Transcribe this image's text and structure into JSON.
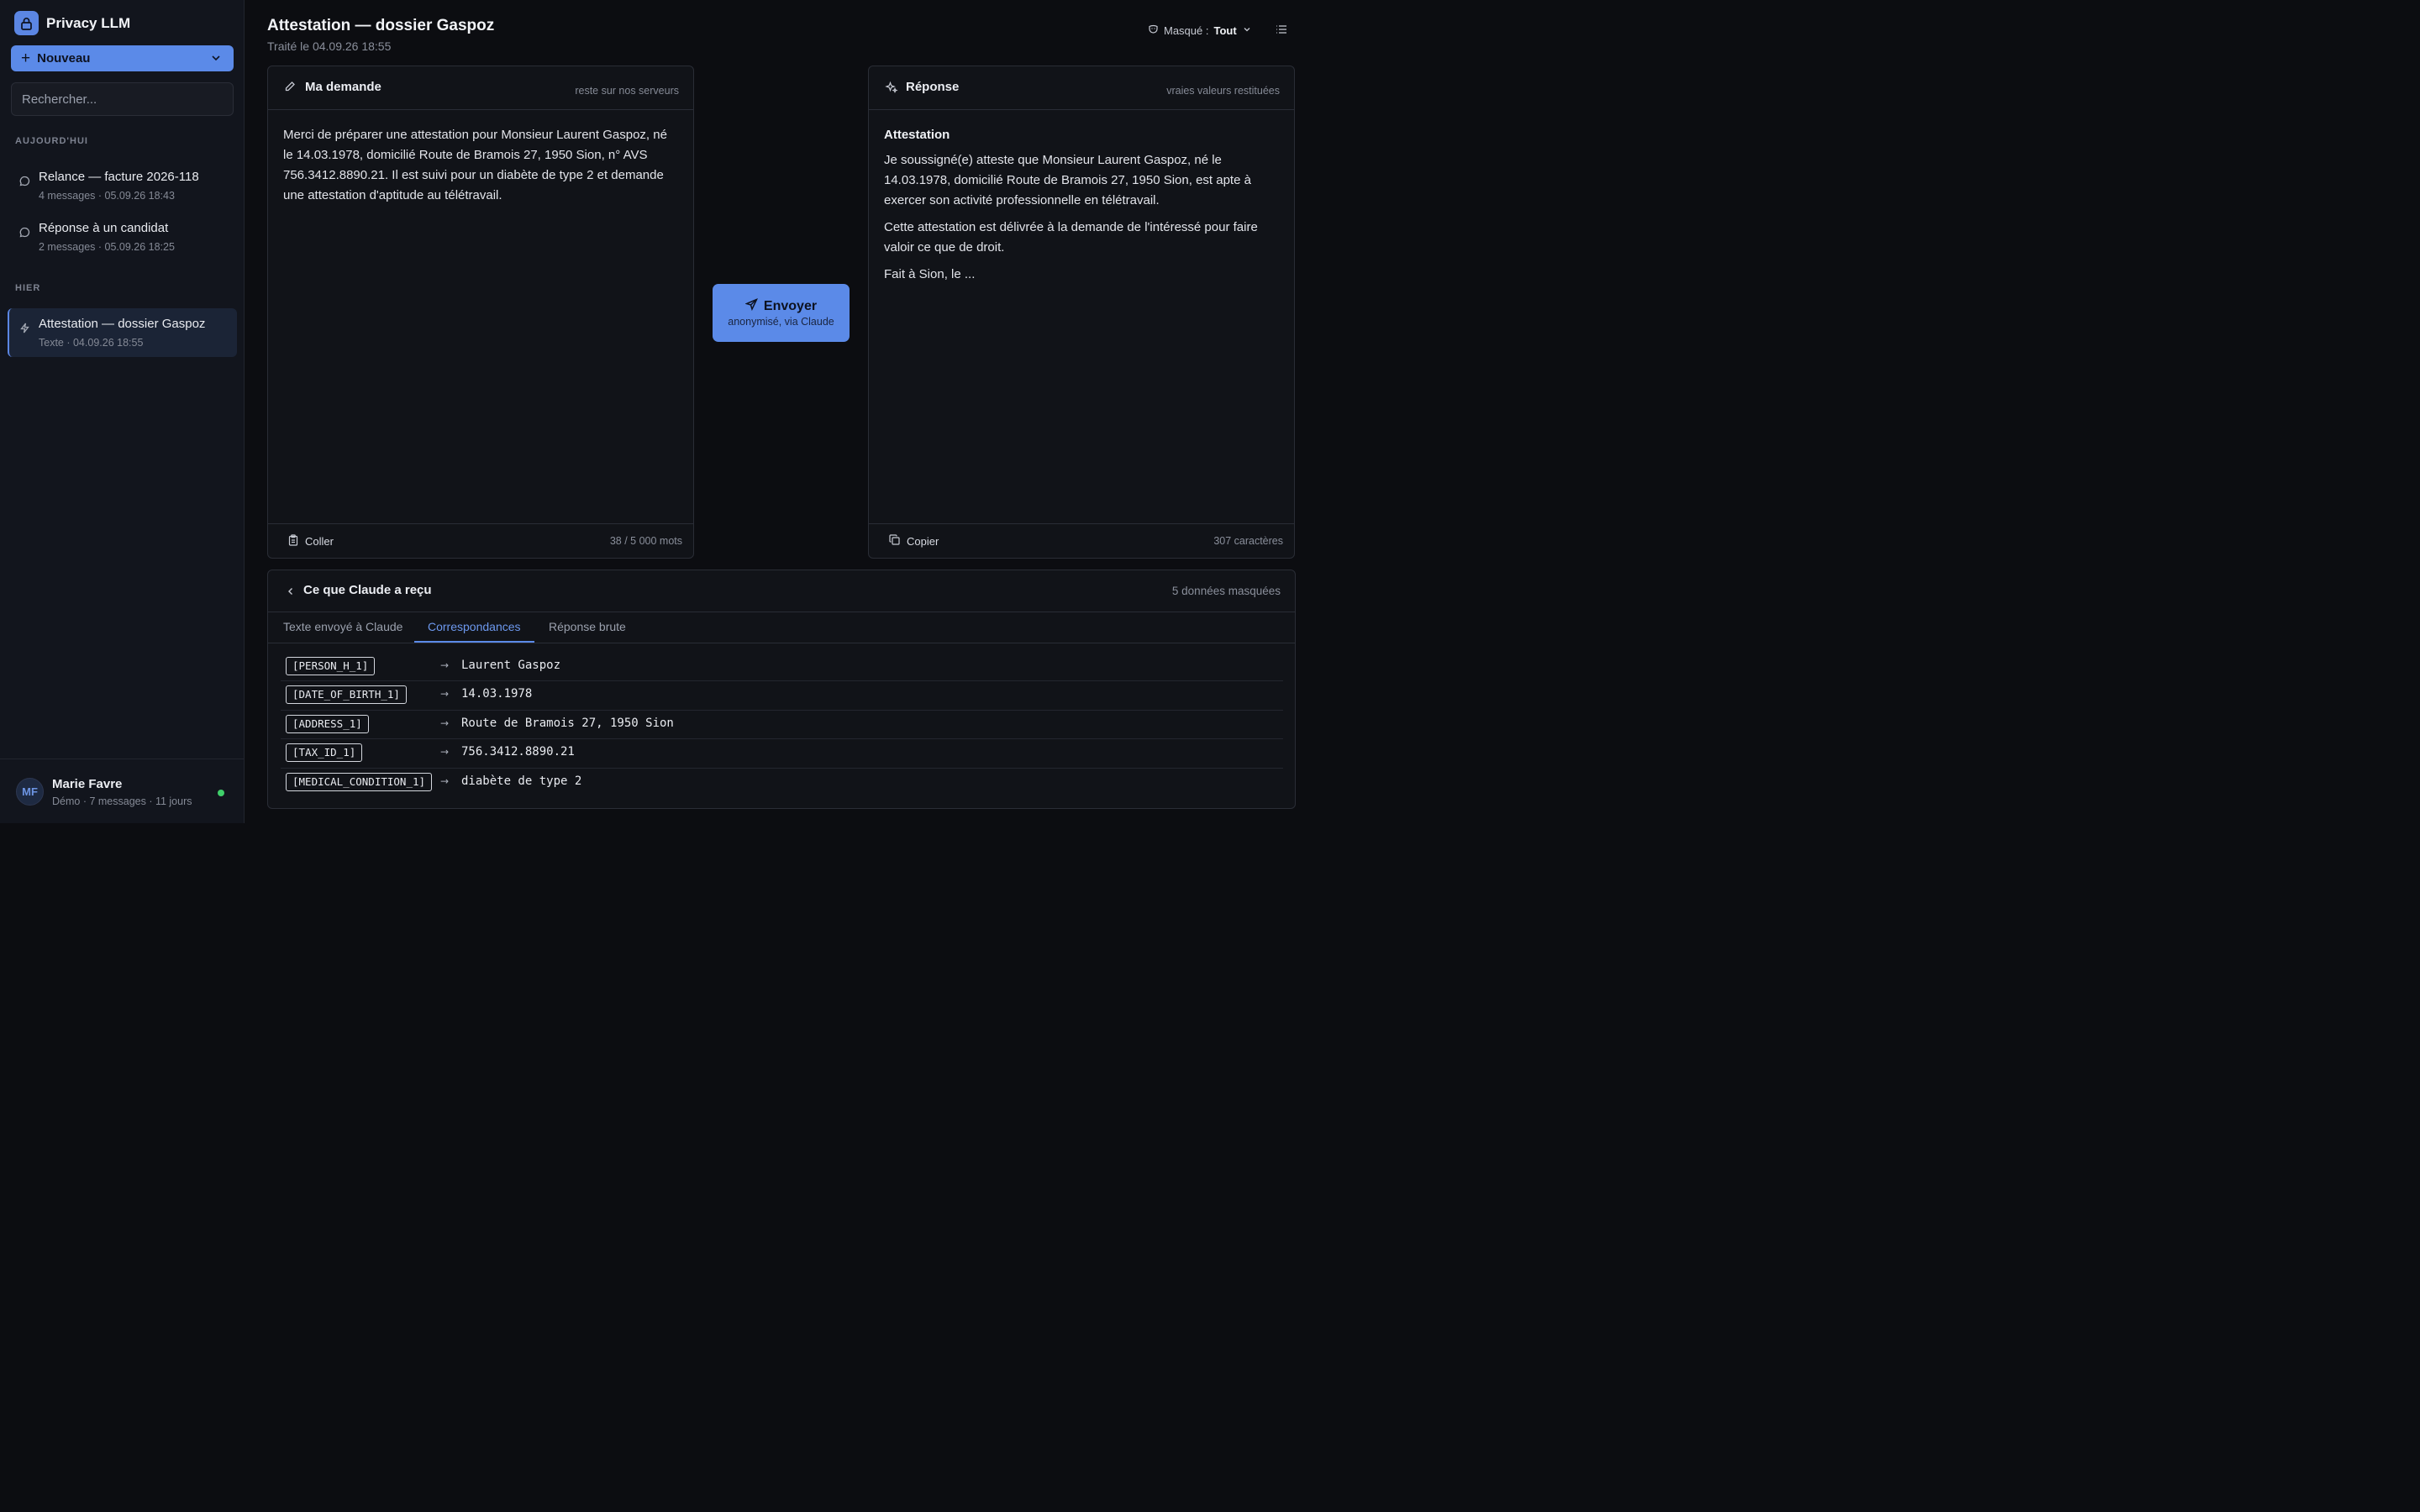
{
  "app": {
    "name": "Privacy LLM",
    "accent": "#5b8ae8"
  },
  "sidebar": {
    "new_button": "Nouveau",
    "search_placeholder": "Rechercher...",
    "sections": [
      {
        "label": "AUJOURD'HUI",
        "items": [
          {
            "title": "Relance — facture 2026-118",
            "meta": "4 messages · 05.09.26 18:43",
            "icon": "chat-bubble-icon"
          },
          {
            "title": "Réponse à un candidat",
            "meta": "2 messages · 05.09.26 18:25",
            "icon": "chat-bubble-icon"
          }
        ]
      },
      {
        "label": "HIER",
        "items": [
          {
            "title": "Attestation — dossier Gaspoz",
            "meta": "Texte · 04.09.26 18:55",
            "icon": "lightning-icon",
            "active": true
          }
        ]
      }
    ],
    "user": {
      "initials": "MF",
      "name": "Marie Favre",
      "meta": "Démo · 7 messages · 11 jours",
      "status_color": "#3fcf6a"
    }
  },
  "header": {
    "title": "Attestation — dossier Gaspoz",
    "subtitle": "Traité le 04.09.26 18:55",
    "mask_label": "Masqué :",
    "mask_value": "Tout"
  },
  "request_panel": {
    "title": "Ma demande",
    "note": "reste sur nos serveurs",
    "text": "Merci de préparer une attestation pour Monsieur Laurent Gaspoz, né le 14.03.1978, domicilié Route de Bramois 27, 1950 Sion, n° AVS 756.3412.8890.21. Il est suivi pour un diabète de type 2 et demande une attestation d'aptitude au télétravail.",
    "footer_button": "Coller",
    "count": "38 / 5 000 mots"
  },
  "send_button": {
    "label": "Envoyer",
    "sublabel": "anonymisé, via Claude"
  },
  "response_panel": {
    "title": "Réponse",
    "note": "vraies valeurs restituées",
    "heading": "Attestation",
    "paragraphs": [
      "Je soussigné(e) atteste que Monsieur Laurent Gaspoz, né le 14.03.1978, domicilié Route de Bramois 27, 1950 Sion, est apte à exercer son activité professionnelle en télétravail.",
      "Cette attestation est délivrée à la demande de l'intéressé pour faire valoir ce que de droit.",
      "Fait à Sion, le ..."
    ],
    "footer_button": "Copier",
    "count": "307 caractères"
  },
  "received": {
    "title": "Ce que Claude a reçu",
    "count": "5 données masquées",
    "tabs": [
      "Texte envoyé à Claude",
      "Correspondances",
      "Réponse brute"
    ],
    "active_tab": 1,
    "mappings": [
      {
        "token": "[PERSON_H_1]",
        "value": "Laurent Gaspoz"
      },
      {
        "token": "[DATE_OF_BIRTH_1]",
        "value": "14.03.1978"
      },
      {
        "token": "[ADDRESS_1]",
        "value": "Route de Bramois 27, 1950 Sion"
      },
      {
        "token": "[TAX_ID_1]",
        "value": "756.3412.8890.21"
      },
      {
        "token": "[MEDICAL_CONDITION_1]",
        "value": "diabète de type 2"
      }
    ]
  }
}
